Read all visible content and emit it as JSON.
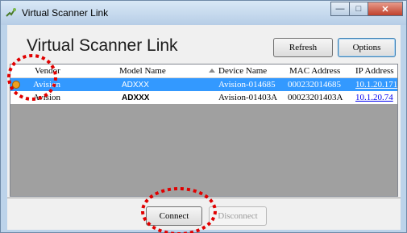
{
  "window": {
    "title": "Virtual Scanner Link",
    "minimize": "—",
    "maximize": "□",
    "close": "✕"
  },
  "header": {
    "title": "Virtual Scanner Link"
  },
  "toolbar": {
    "refresh_label": "Refresh",
    "options_label": "Options"
  },
  "table": {
    "columns": [
      "Vendor",
      "Model Name",
      "Device Name",
      "MAC Address",
      "IP Address"
    ],
    "rows": [
      {
        "vendor": "Avision",
        "model": "ADXXX",
        "device": "Avision-014685",
        "mac": "000232014685",
        "ip": "10.1.20.171",
        "selected": true
      },
      {
        "vendor": "Avision",
        "model": "ADXXX",
        "device": "Avision-01403A",
        "mac": "00023201403A",
        "ip": "10.1.20.74",
        "selected": false
      }
    ]
  },
  "footer": {
    "connect_label": "Connect",
    "disconnect_label": "Disconnect"
  },
  "colors": {
    "selection": "#3399ff",
    "annotation": "#e00000",
    "link": "#0000ee"
  }
}
